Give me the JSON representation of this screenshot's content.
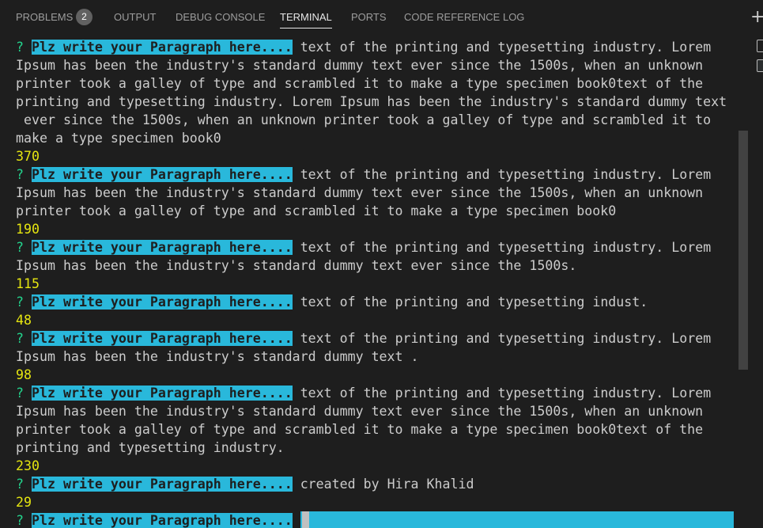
{
  "tabs": [
    {
      "label": "PROBLEMS",
      "badge": "2",
      "active": false
    },
    {
      "label": "OUTPUT",
      "active": false
    },
    {
      "label": "DEBUG CONSOLE",
      "active": false
    },
    {
      "label": "TERMINAL",
      "active": true
    },
    {
      "label": "PORTS",
      "active": false
    },
    {
      "label": "CODE REFERENCE LOG",
      "active": false
    }
  ],
  "toolbar": {
    "new_terminal_glyph": "+"
  },
  "terminal": {
    "question_mark": "?",
    "prompt_label": "Plz write your Paragraph here....",
    "entries": [
      {
        "first": "text of the printing and typesetting industry. Lorem",
        "rest": [
          "Ipsum has been the industry's standard dummy text ever since the 1500s, when an unknown",
          "printer took a galley of type and scrambled it to make a type specimen book0text of the",
          "printing and typesetting industry. Lorem Ipsum has been the industry's standard dummy text",
          " ever since the 1500s, when an unknown printer took a galley of type and scrambled it to",
          "make a type specimen book0"
        ],
        "count": "370"
      },
      {
        "first": "text of the printing and typesetting industry. Lorem",
        "rest": [
          "Ipsum has been the industry's standard dummy text ever since the 1500s, when an unknown",
          "printer took a galley of type and scrambled it to make a type specimen book0"
        ],
        "count": "190"
      },
      {
        "first": "text of the printing and typesetting industry. Lorem",
        "rest": [
          "Ipsum has been the industry's standard dummy text ever since the 1500s."
        ],
        "count": "115"
      },
      {
        "first": "text of the printing and typesetting indust.",
        "rest": [],
        "count": "48"
      },
      {
        "first": "text of the printing and typesetting industry. Lorem",
        "rest": [
          "Ipsum has been the industry's standard dummy text ."
        ],
        "count": "98"
      },
      {
        "first": "text of the printing and typesetting industry. Lorem",
        "rest": [
          "Ipsum has been the industry's standard dummy text ever since the 1500s, when an unknown",
          "printer took a galley of type and scrambled it to make a type specimen book0text of the",
          "printing and typesetting industry."
        ],
        "count": "230"
      },
      {
        "first": "created by Hira Khalid",
        "rest": [],
        "count": "29"
      }
    ],
    "current_input": ""
  },
  "colors": {
    "background": "#1e1e1e",
    "prompt_bg": "#29b8db",
    "question_mark": "#23d18b",
    "count_text": "#e5e510",
    "text": "#cccccc"
  }
}
